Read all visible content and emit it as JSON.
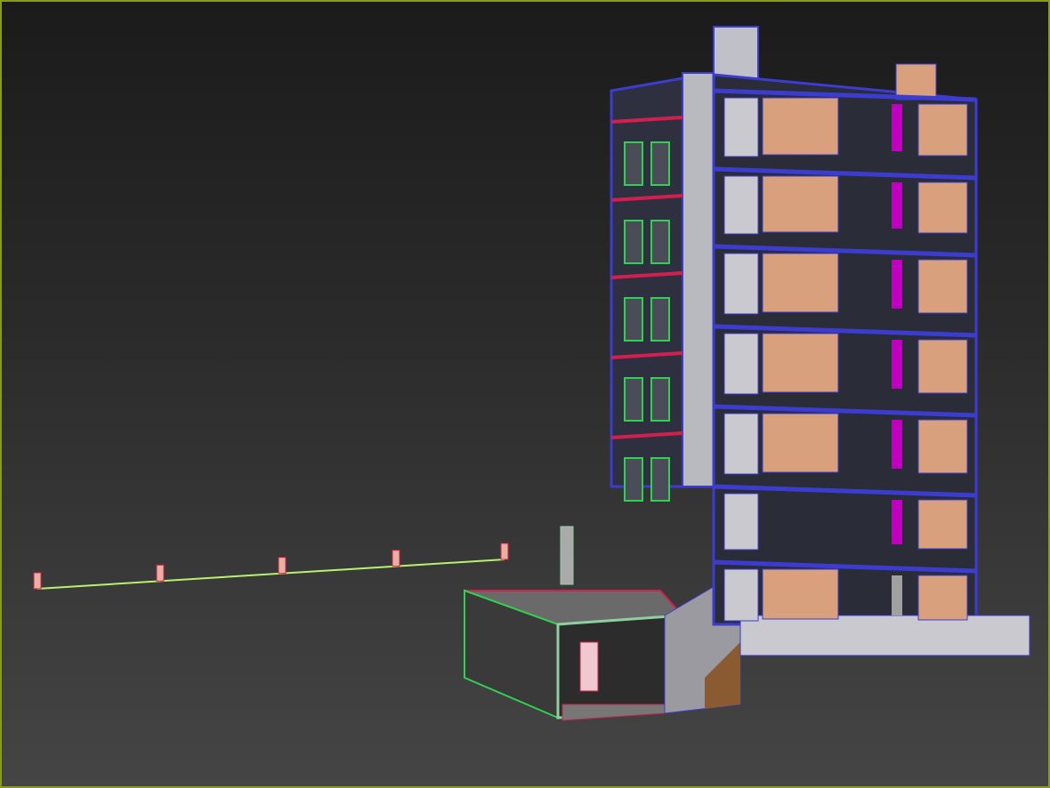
{
  "viewport": {
    "active_border_color": "#8a9a20",
    "background_top": "#1b1b1b",
    "background_bottom": "#454545"
  },
  "model": {
    "floors": 7,
    "fence_posts": 5,
    "colors": {
      "wall": "#c9c9cf",
      "brick": "#d9a07e",
      "edge_blue": "#3c3cd0",
      "edge_red": "#d02050",
      "edge_green": "#30d050",
      "magenta": "#c000c0",
      "fence": "#b8f070"
    }
  }
}
